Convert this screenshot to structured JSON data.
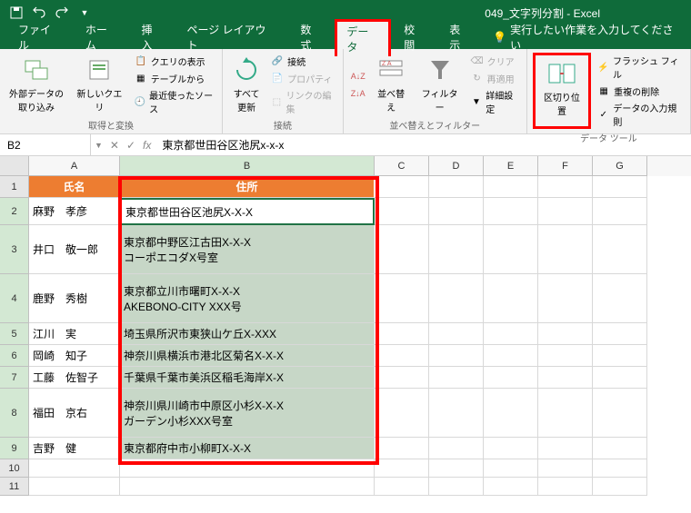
{
  "titlebar": {
    "title": "049_文字列分割 - Excel"
  },
  "menu": {
    "file": "ファイル",
    "home": "ホーム",
    "insert": "挿入",
    "pagelayout": "ページ レイアウト",
    "formulas": "数式",
    "data": "データ",
    "review": "校閲",
    "view": "表示",
    "tellme": "実行したい作業を入力してください"
  },
  "ribbon": {
    "g1": {
      "external": "外部データの\n取り込み",
      "newquery": "新しいクエリ",
      "showqueries": "クエリの表示",
      "fromtable": "テーブルから",
      "recent": "最近使ったソース",
      "label": "取得と変換"
    },
    "g2": {
      "refreshall": "すべて\n更新",
      "connections": "接続",
      "properties": "プロパティ",
      "editlinks": "リンクの編集",
      "label": "接続"
    },
    "g3": {
      "sort": "並べ替え",
      "filter": "フィルター",
      "clear": "クリア",
      "reapply": "再適用",
      "advanced": "詳細設定",
      "label": "並べ替えとフィルター"
    },
    "g4": {
      "texttocolumns": "区切り位置",
      "flashfill": "フラッシュ フィル",
      "removedupes": "重複の削除",
      "validation": "データの入力規則",
      "label": "データ ツール"
    }
  },
  "namebox": {
    "cell": "B2",
    "formula": "東京都世田谷区池尻x-x-x"
  },
  "cols": {
    "A": "A",
    "B": "B",
    "C": "C",
    "D": "D",
    "E": "E",
    "F": "F",
    "G": "G"
  },
  "headers": {
    "name": "氏名",
    "addr": "住所"
  },
  "table": {
    "a2": "麻野　孝彦",
    "b2": "東京都世田谷区池尻X-X-X",
    "a3": "井口　敬一郎",
    "b3": "東京都中野区江古田X-X-X\nコーポエコダX号室",
    "a4": "鹿野　秀樹",
    "b4": "東京都立川市曙町X-X-X\nAKEBONO-CITY XXX号",
    "a5": "江川　実",
    "b5": "埼玉県所沢市東狭山ケ丘X-XXX",
    "a6": "岡崎　知子",
    "b6": "神奈川県横浜市港北区菊名X-X-X",
    "a7": "工藤　佐智子",
    "b7": "千葉県千葉市美浜区稲毛海岸X-X",
    "a8": "福田　京右",
    "b8": "神奈川県川崎市中原区小杉X-X-X\nガーデン小杉XXX号室",
    "a9": "吉野　健",
    "b9": "東京都府中市小柳町X-X-X"
  }
}
